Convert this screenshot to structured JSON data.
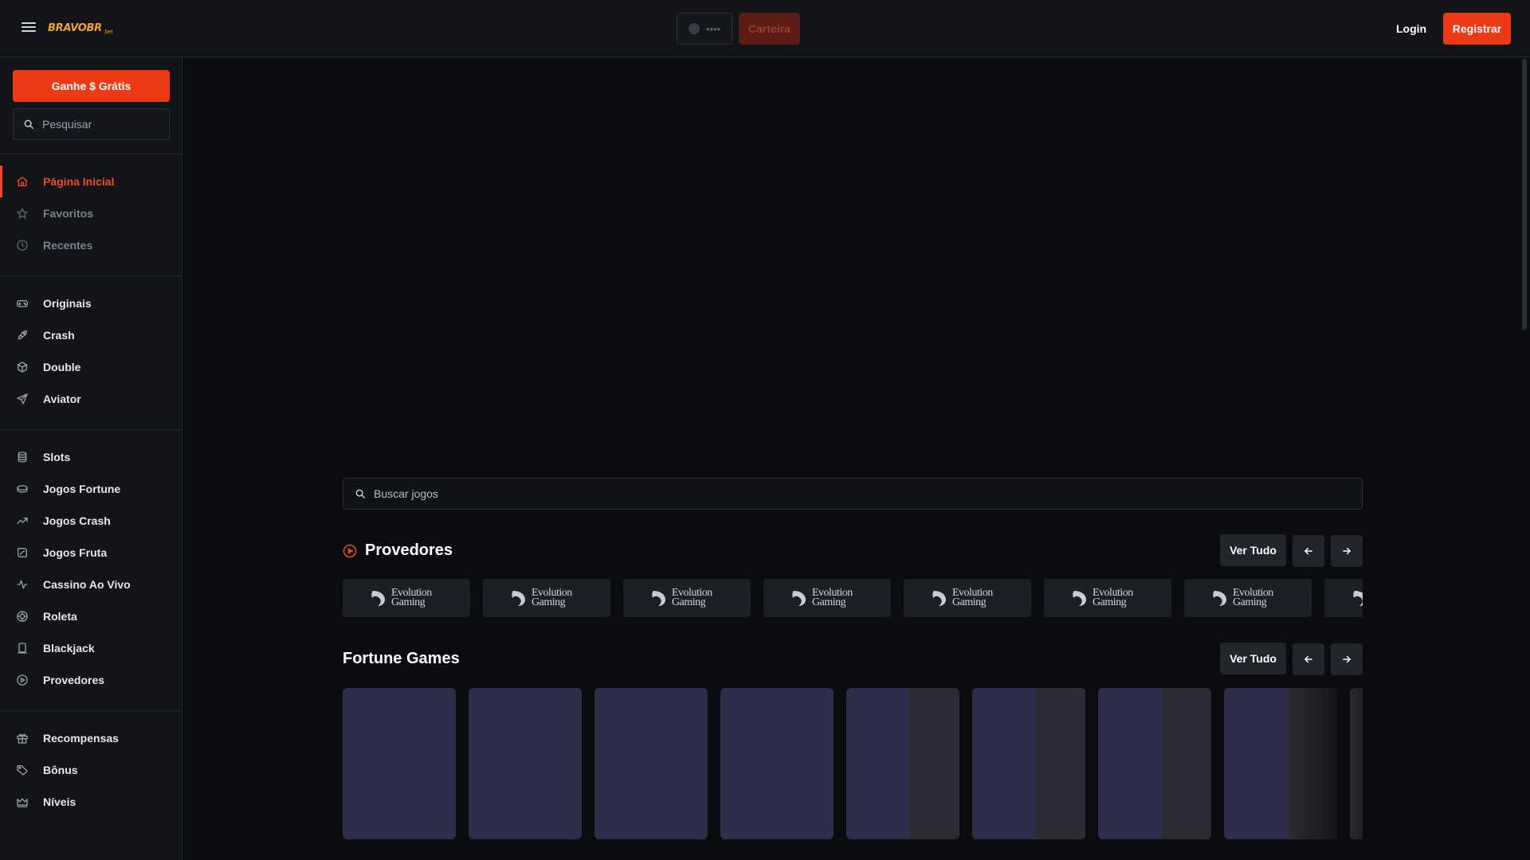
{
  "header": {
    "logo_text": "BRAVOBR",
    "logo_sub": ".bet",
    "balance_mask": "••••",
    "wallet_label": "Carteira",
    "login_label": "Login",
    "register_label": "Registrar"
  },
  "sidebar": {
    "promo_label": "Ganhe $ Grátis",
    "search_placeholder": "Pesquisar",
    "groups": [
      [
        {
          "label": "Página Inicial",
          "icon": "home-icon",
          "state": "active"
        },
        {
          "label": "Favoritos",
          "icon": "star-icon",
          "state": "muted"
        },
        {
          "label": "Recentes",
          "icon": "clock-icon",
          "state": "muted"
        }
      ],
      [
        {
          "label": "Originais",
          "icon": "gamepad-icon"
        },
        {
          "label": "Crash",
          "icon": "rocket-icon"
        },
        {
          "label": "Double",
          "icon": "cube-icon"
        },
        {
          "label": "Aviator",
          "icon": "plane-icon"
        }
      ],
      [
        {
          "label": "Slots",
          "icon": "slots-icon"
        },
        {
          "label": "Jogos Fortune",
          "icon": "coins-icon"
        },
        {
          "label": "Jogos Crash",
          "icon": "trend-icon"
        },
        {
          "label": "Jogos Fruta",
          "icon": "fruit-icon"
        },
        {
          "label": "Cassino Ao Vivo",
          "icon": "pulse-icon"
        },
        {
          "label": "Roleta",
          "icon": "roulette-icon"
        },
        {
          "label": "Blackjack",
          "icon": "cards-icon"
        },
        {
          "label": "Provedores",
          "icon": "play-circle-icon"
        }
      ],
      [
        {
          "label": "Recompensas",
          "icon": "gift-icon"
        },
        {
          "label": "Bônus",
          "icon": "tag-icon"
        },
        {
          "label": "Níveis",
          "icon": "crown-icon"
        }
      ]
    ]
  },
  "main": {
    "search_placeholder": "Buscar jogos",
    "providers": {
      "title": "Provedores",
      "view_all": "Ver Tudo",
      "items": [
        "Evolution Gaming",
        "Evolution Gaming",
        "Evolution Gaming",
        "Evolution Gaming",
        "Evolution Gaming",
        "Evolution Gaming",
        "Evolution Gaming",
        "Evolution Gaming"
      ]
    },
    "fortune": {
      "title": "Fortune Games",
      "view_all": "Ver Tudo",
      "card_count": 9
    }
  },
  "colors": {
    "accent": "#ec3a16",
    "accent_text": "#f04a25",
    "background": "#0b0c0f",
    "panel": "#121419",
    "card": "#2d2f4a"
  }
}
